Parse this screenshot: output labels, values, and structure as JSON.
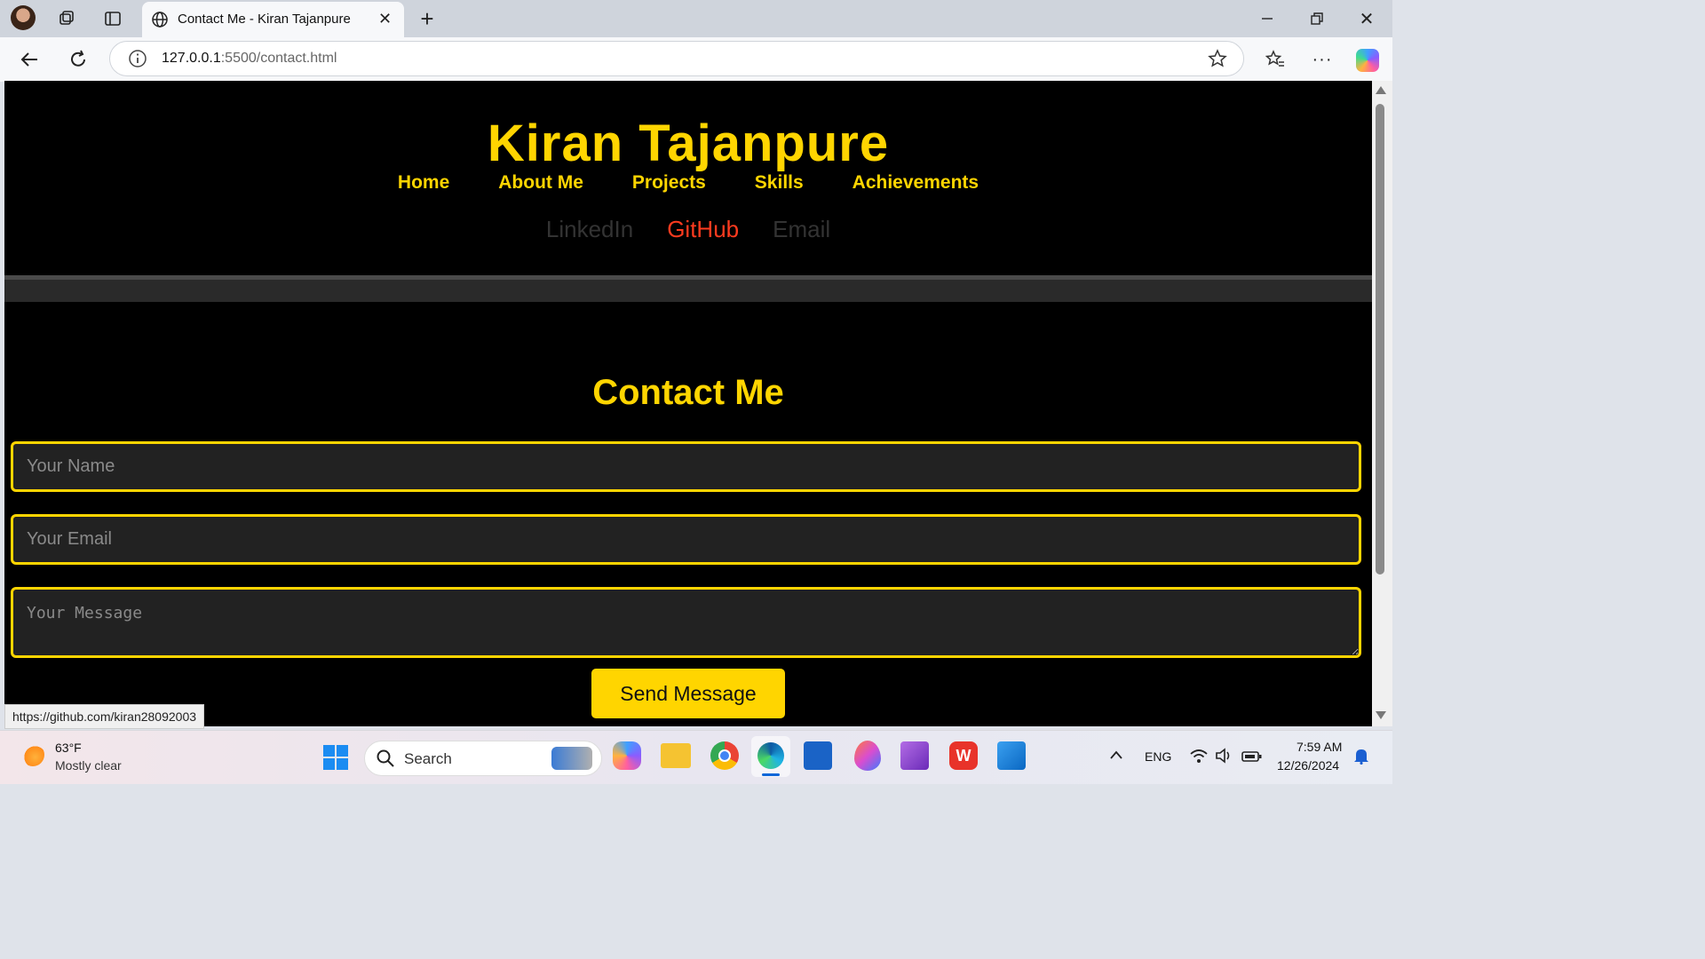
{
  "browser": {
    "tab_title": "Contact Me - Kiran Tajanpure",
    "url_host": "127.0.0.1",
    "url_path": ":5500/contact.html",
    "status_url": "https://github.com/kiran28092003"
  },
  "site": {
    "title": "Kiran Tajanpure",
    "nav": [
      "Home",
      "About Me",
      "Projects",
      "Skills",
      "Achievements"
    ],
    "social": [
      "LinkedIn",
      "GitHub",
      "Email"
    ],
    "social_active": "GitHub"
  },
  "contact": {
    "heading": "Contact Me",
    "name_placeholder": "Your Name",
    "email_placeholder": "Your Email",
    "message_placeholder": "Your Message",
    "send_label": "Send Message"
  },
  "taskbar": {
    "weather_temp": "63°F",
    "weather_desc": "Mostly clear",
    "search_label": "Search",
    "lang": "ENG",
    "time": "7:59 AM",
    "date": "12/26/2024"
  },
  "colors": {
    "accent": "#ffd500",
    "active_link": "#ff3b1f",
    "background": "#000000"
  }
}
